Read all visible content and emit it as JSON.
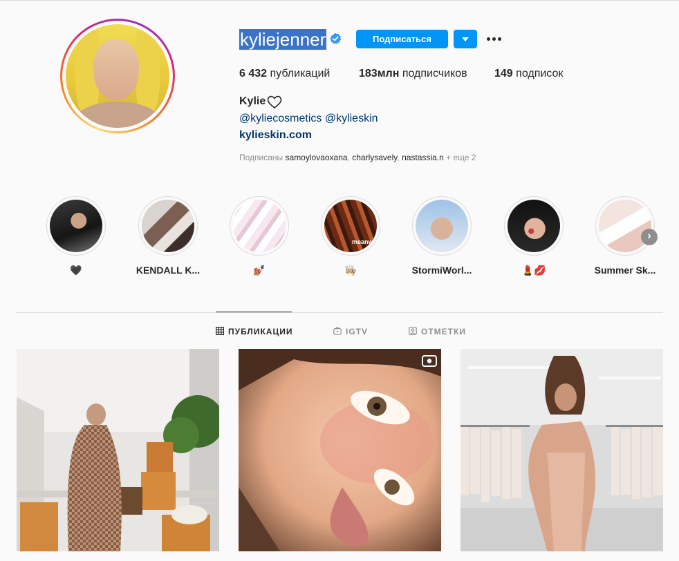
{
  "profile": {
    "username": "kyliejenner",
    "follow_label": "Подписаться",
    "full_name": "Kylie",
    "bio_mentions": "@kyliecosmetics @kylieskin",
    "website": "kylieskin.com",
    "stats": {
      "posts_count": "6 432",
      "posts_label": "публикаций",
      "followers_count": "183млн",
      "followers_label": "подписчиков",
      "following_count": "149",
      "following_label": "подписок"
    },
    "followed_by": {
      "prefix": "Подписаны",
      "names": [
        "samoylovaoxana",
        "charlysavely",
        "nastassia.n"
      ],
      "suffix": "+ еще 2"
    }
  },
  "highlights": [
    {
      "label": "🖤"
    },
    {
      "label": "KENDALL K..."
    },
    {
      "label": "💅🏽"
    },
    {
      "label": "👩🏼‍🍳"
    },
    {
      "label": "StormiWorl..."
    },
    {
      "label": "💄💋"
    },
    {
      "label": "Summer Sk..."
    }
  ],
  "highlight_overlay_text": "meanwhi",
  "tabs": [
    {
      "label": "ПУБЛИКАЦИИ",
      "icon": "grid-icon",
      "active": true
    },
    {
      "label": "IGTV",
      "icon": "igtv-icon",
      "active": false
    },
    {
      "label": "ОТМЕТКИ",
      "icon": "tagged-icon",
      "active": false
    }
  ],
  "colors": {
    "accent": "#0095f6",
    "link": "#00376b",
    "text": "#262626",
    "muted": "#8e8e8e",
    "background": "#fafafa",
    "selection": "#3a73c8"
  }
}
